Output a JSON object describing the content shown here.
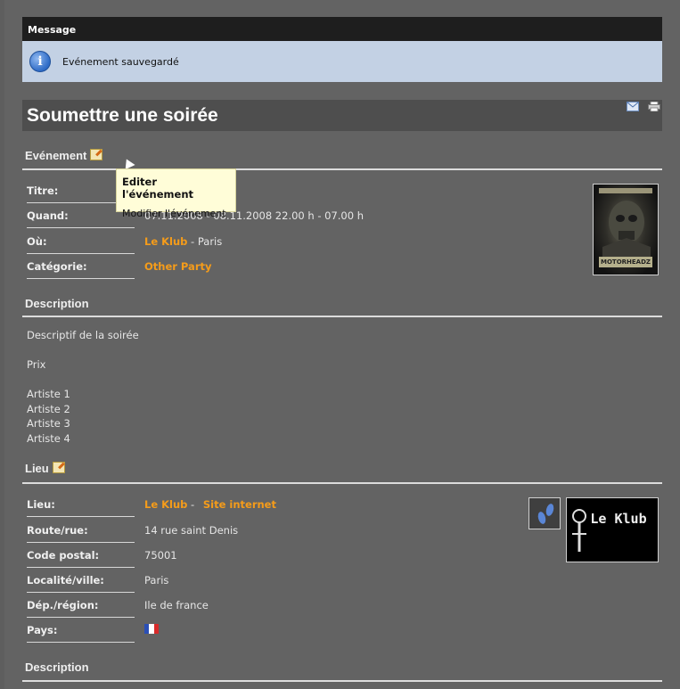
{
  "message": {
    "header": "Message",
    "text": "Evénement sauvegardé",
    "icon": "info-icon"
  },
  "title": "Soumettre une soirée",
  "toolbar": {
    "email_icon": "email-icon",
    "print_icon": "print-icon"
  },
  "tooltip": {
    "title": "Editer l'événement",
    "text": "Modifier l'événement"
  },
  "event_section": {
    "heading": "Evénement",
    "fields": {
      "titre_label": "Titre:",
      "quand_label": "Quand:",
      "quand_value": "07.11.2008 - 08.11.2008 22.00 h - 07.00 h",
      "ou_label": "Où:",
      "ou_link": "Le Klub",
      "ou_city": " - Paris",
      "categorie_label": "Catégorie:",
      "categorie_value": "Other Party"
    },
    "flyer_text": "MOTORHEADZ"
  },
  "description_section": {
    "heading": "Description",
    "lines": [
      "Descriptif de la soirée",
      "",
      "Prix",
      "",
      "Artiste 1",
      "Artiste 2",
      "Artiste 3",
      "Artiste 4"
    ]
  },
  "lieu_section": {
    "heading": "Lieu",
    "fields": {
      "lieu_label": "Lieu:",
      "lieu_link": "Le Klub",
      "separator": " - ",
      "site_link": "Site internet",
      "route_label": "Route/rue:",
      "route_value": "14 rue saint Denis",
      "cp_label": "Code postal:",
      "cp_value": "75001",
      "ville_label": "Localité/ville:",
      "ville_value": "Paris",
      "region_label": "Dép./région:",
      "region_value": "Ile de france",
      "pays_label": "Pays:",
      "pays_flag": "france-flag-icon"
    },
    "logo_text": "Le Klub"
  },
  "description2_heading": "Description",
  "colors": {
    "link": "#f59c1a",
    "message_bg": "#c3d1e4",
    "tooltip_bg": "#fffdd8"
  }
}
